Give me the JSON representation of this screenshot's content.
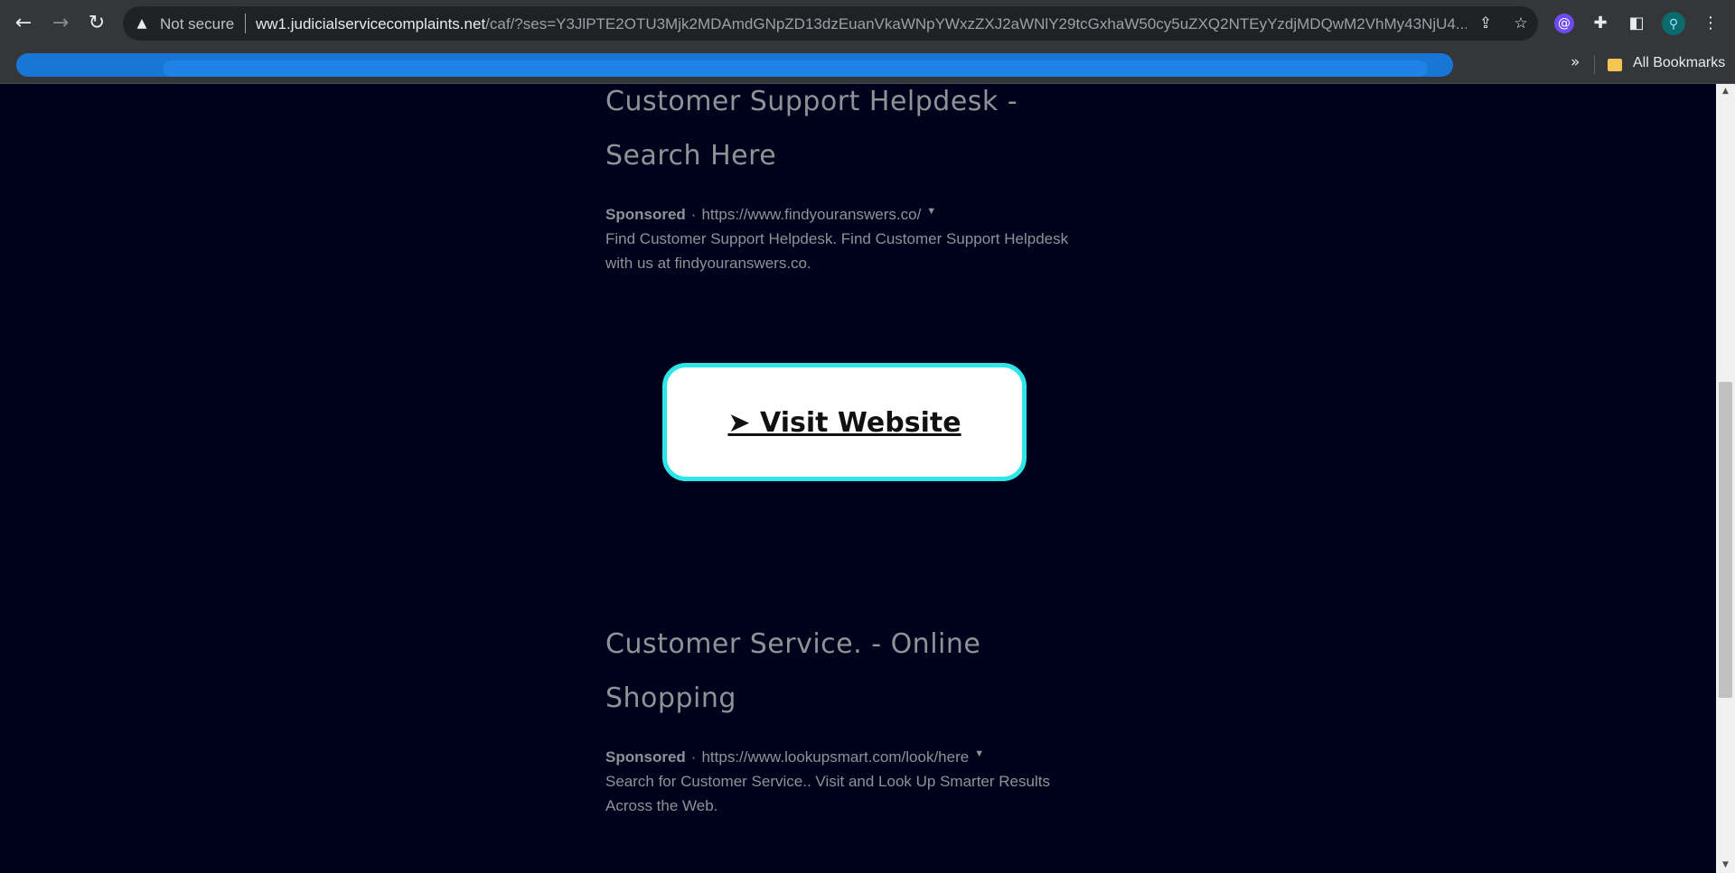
{
  "browser": {
    "back_icon": "←",
    "forward_icon": "→",
    "reload_icon": "↻",
    "security_label": "Not secure",
    "url_domain": "ww1.judicialservicecomplaints.net",
    "url_path": "/caf/?ses=Y3JlPTE2OTU3Mjk2MDAmdGNpZD13dzEuanVkaWNpYWxzZXJ2aWNlY29tcGxhaW50cy5uZXQ2NTEyYzdjMDQwM2VhMy43NjU4...",
    "bookmarks_overflow": "»",
    "all_bookmarks_label": "All Bookmarks"
  },
  "ads": [
    {
      "title_line1": "Customer Support Helpdesk -",
      "title_line2": "Search Here",
      "sponsored": "Sponsored",
      "url": "https://www.findyouranswers.co/",
      "description": "Find Customer Support Helpdesk. Find Customer Support Helpdesk with us at findyouranswers.co."
    },
    {
      "title_line1": "Customer Service. - Online",
      "title_line2": "Shopping",
      "sponsored": "Sponsored",
      "url": "https://www.lookupsmart.com/look/here",
      "description": "Search for Customer Service.. Visit and Look Up Smarter Results Across the Web."
    }
  ],
  "visit_button": {
    "label": "➤ Visit Website"
  },
  "colors": {
    "page_bg": "#00021c",
    "button_border": "#2ee6ea",
    "text_muted": "#8f9296"
  }
}
